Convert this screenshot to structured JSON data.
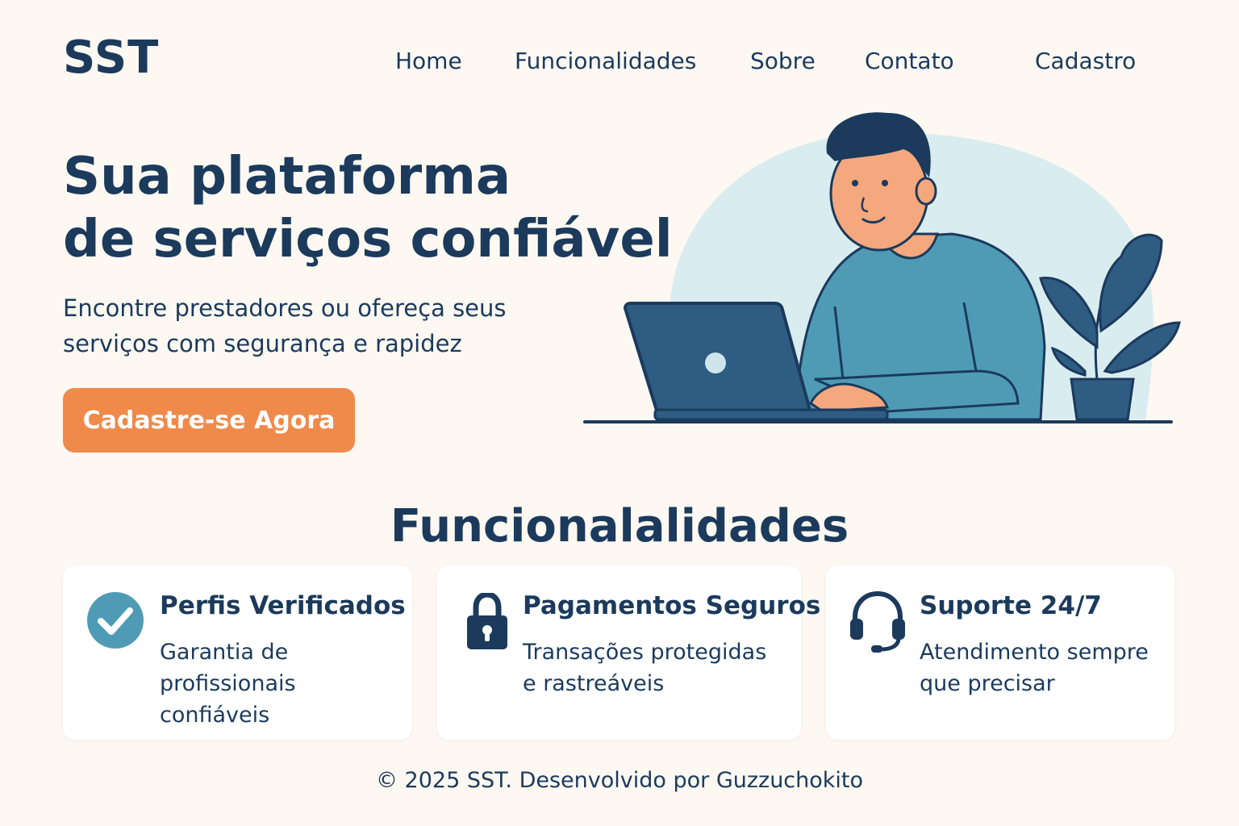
{
  "header": {
    "logo": "SST",
    "nav": [
      "Home",
      "Funcionalidades",
      "Sobre",
      "Contato",
      "Cadastro"
    ]
  },
  "hero": {
    "title_lines": [
      "Sua plataforma",
      "de serviços confiável"
    ],
    "subtitle_lines": [
      "Encontre prestadores ou ofereça seus",
      "serviços com segurança e rapidez"
    ],
    "cta_label": "Cadastre-se Agora"
  },
  "features": {
    "title": "Funcionalalidades",
    "cards": [
      {
        "icon": "check-circle-icon",
        "title": "Perfis Verificados",
        "lines": [
          "Garantia de",
          "profissionais",
          "confiáveis"
        ]
      },
      {
        "icon": "lock-icon",
        "title": "Pagamentos Seguros",
        "lines": [
          "Transações protegidas",
          "e rastreáveis"
        ]
      },
      {
        "icon": "headset-icon",
        "title": "Suporte 24/7",
        "lines": [
          "Atendimento sempre",
          "que precisar"
        ]
      }
    ]
  },
  "footer": {
    "text": "© 2025 SST. Desenvolvido por Guzzuchokito"
  },
  "colors": {
    "background": "#fdf8f2",
    "primary_text": "#1b3a5c",
    "accent": "#f08a4b",
    "teal": "#4f9bb5"
  }
}
